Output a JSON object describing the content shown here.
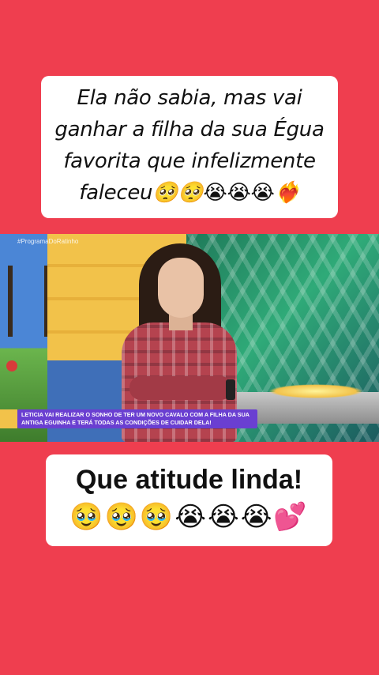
{
  "top_card": {
    "line1": "Ela não sabia, mas vai",
    "line2": "ganhar a filha da sua Égua",
    "line3": "favorita que infelizmente",
    "line4_text": "faleceu",
    "line4_emojis": "🥺🥺😭😭😭❤️‍🔥"
  },
  "video": {
    "watermark": "#ProgramaDoRatinho",
    "caption": "LETICIA VAI REALIZAR O SONHO DE TER UM NOVO CAVALO COM A FILHA DA SUA ANTIGA EGUINHA E TERÁ TODAS AS CONDIÇÕES DE CUIDAR DELA!"
  },
  "bottom_card": {
    "title": "Que atitude linda!",
    "emojis": "🥹🥹🥹😭😭😭💕"
  },
  "colors": {
    "background": "#ef3e4f",
    "card": "#ffffff",
    "caption_bg": "#6a3fd1"
  }
}
